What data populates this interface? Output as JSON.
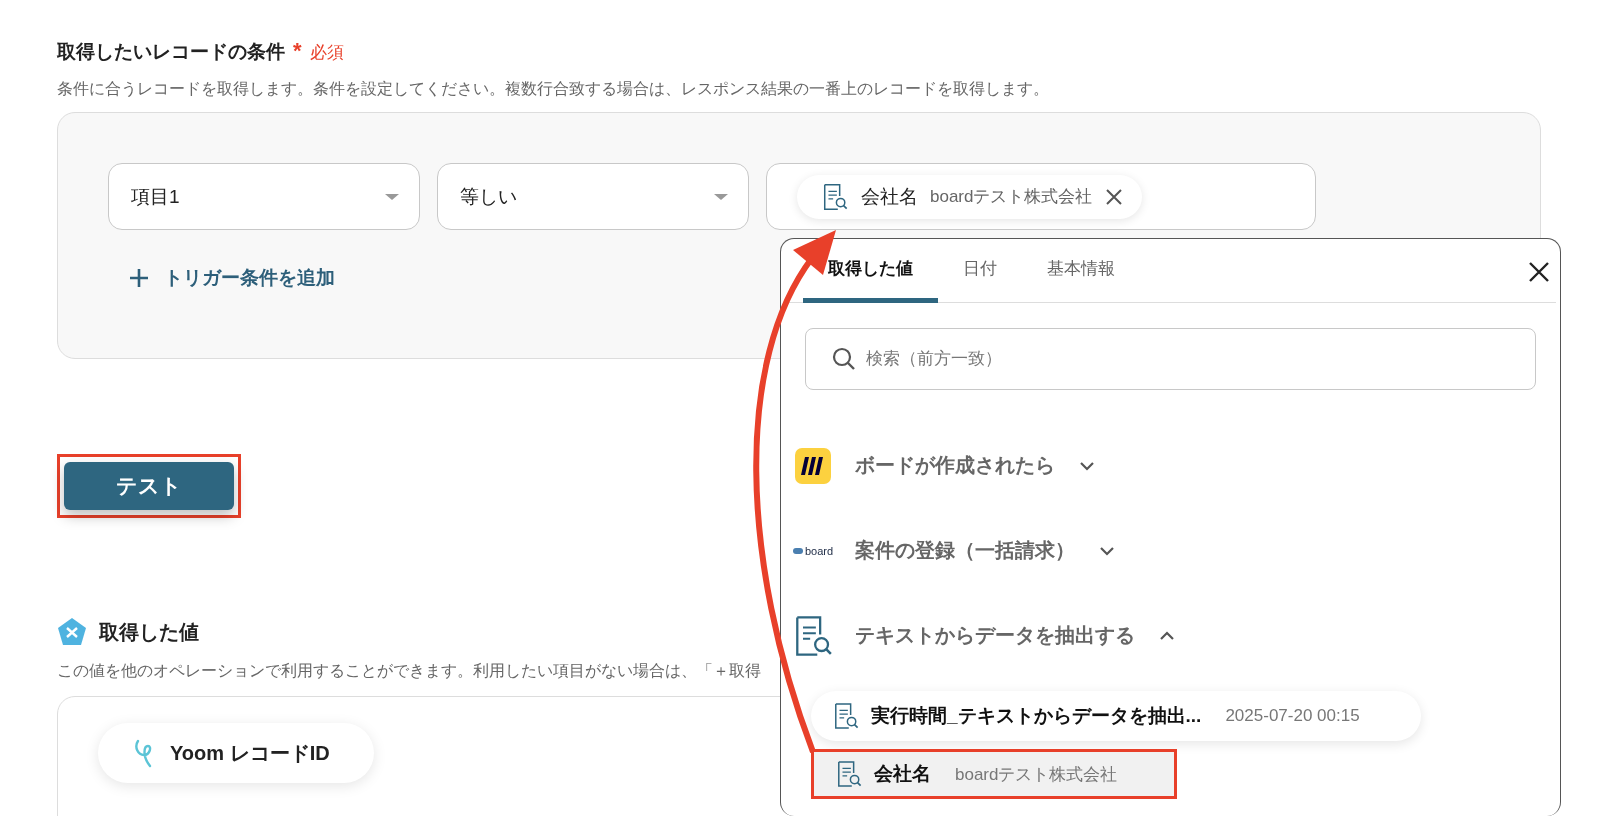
{
  "section": {
    "title": "取得したいレコードの条件",
    "required_mark": "*",
    "required_label": "必須",
    "description": "条件に合うレコードを取得します。条件を設定してください。複数行合致する場合は、レスポンス結果の一番上のレコードを取得します。"
  },
  "condition": {
    "field": "項目1",
    "operator": "等しい",
    "value_chip": {
      "name": "会社名",
      "value": "boardテスト株式会社"
    }
  },
  "add_condition": {
    "label": "トリガー条件を追加"
  },
  "test_button": {
    "label": "テスト",
    "highlighted": true
  },
  "outputs": {
    "title": "取得した値",
    "description": "この値を他のオペレーションで利用することができます。利用したい項目がない場合は、「＋取得",
    "chips": [
      {
        "label": "Yoom レコードID"
      }
    ]
  },
  "popover": {
    "tabs": [
      {
        "label": "取得した値",
        "selected": true
      },
      {
        "label": "日付",
        "selected": false
      },
      {
        "label": "基本情報",
        "selected": false
      }
    ],
    "search": {
      "placeholder": "検索（前方一致）"
    },
    "groups": [
      {
        "kind": "miro",
        "title": "ボードが作成されたら",
        "expanded": false
      },
      {
        "kind": "board",
        "logo": "board",
        "title": "案件の登録（一括請求）",
        "expanded": false
      },
      {
        "kind": "extract",
        "title": "テキストからデータを抽出する",
        "expanded": true,
        "items": [
          {
            "name": "実行時間_テキストからデータを抽出...",
            "value": "2025-07-20 00:15",
            "highlighted": false
          },
          {
            "name": "会社名",
            "value": "boardテスト株式会社",
            "highlighted": true
          }
        ]
      }
    ]
  },
  "annotation_arrow": true
}
